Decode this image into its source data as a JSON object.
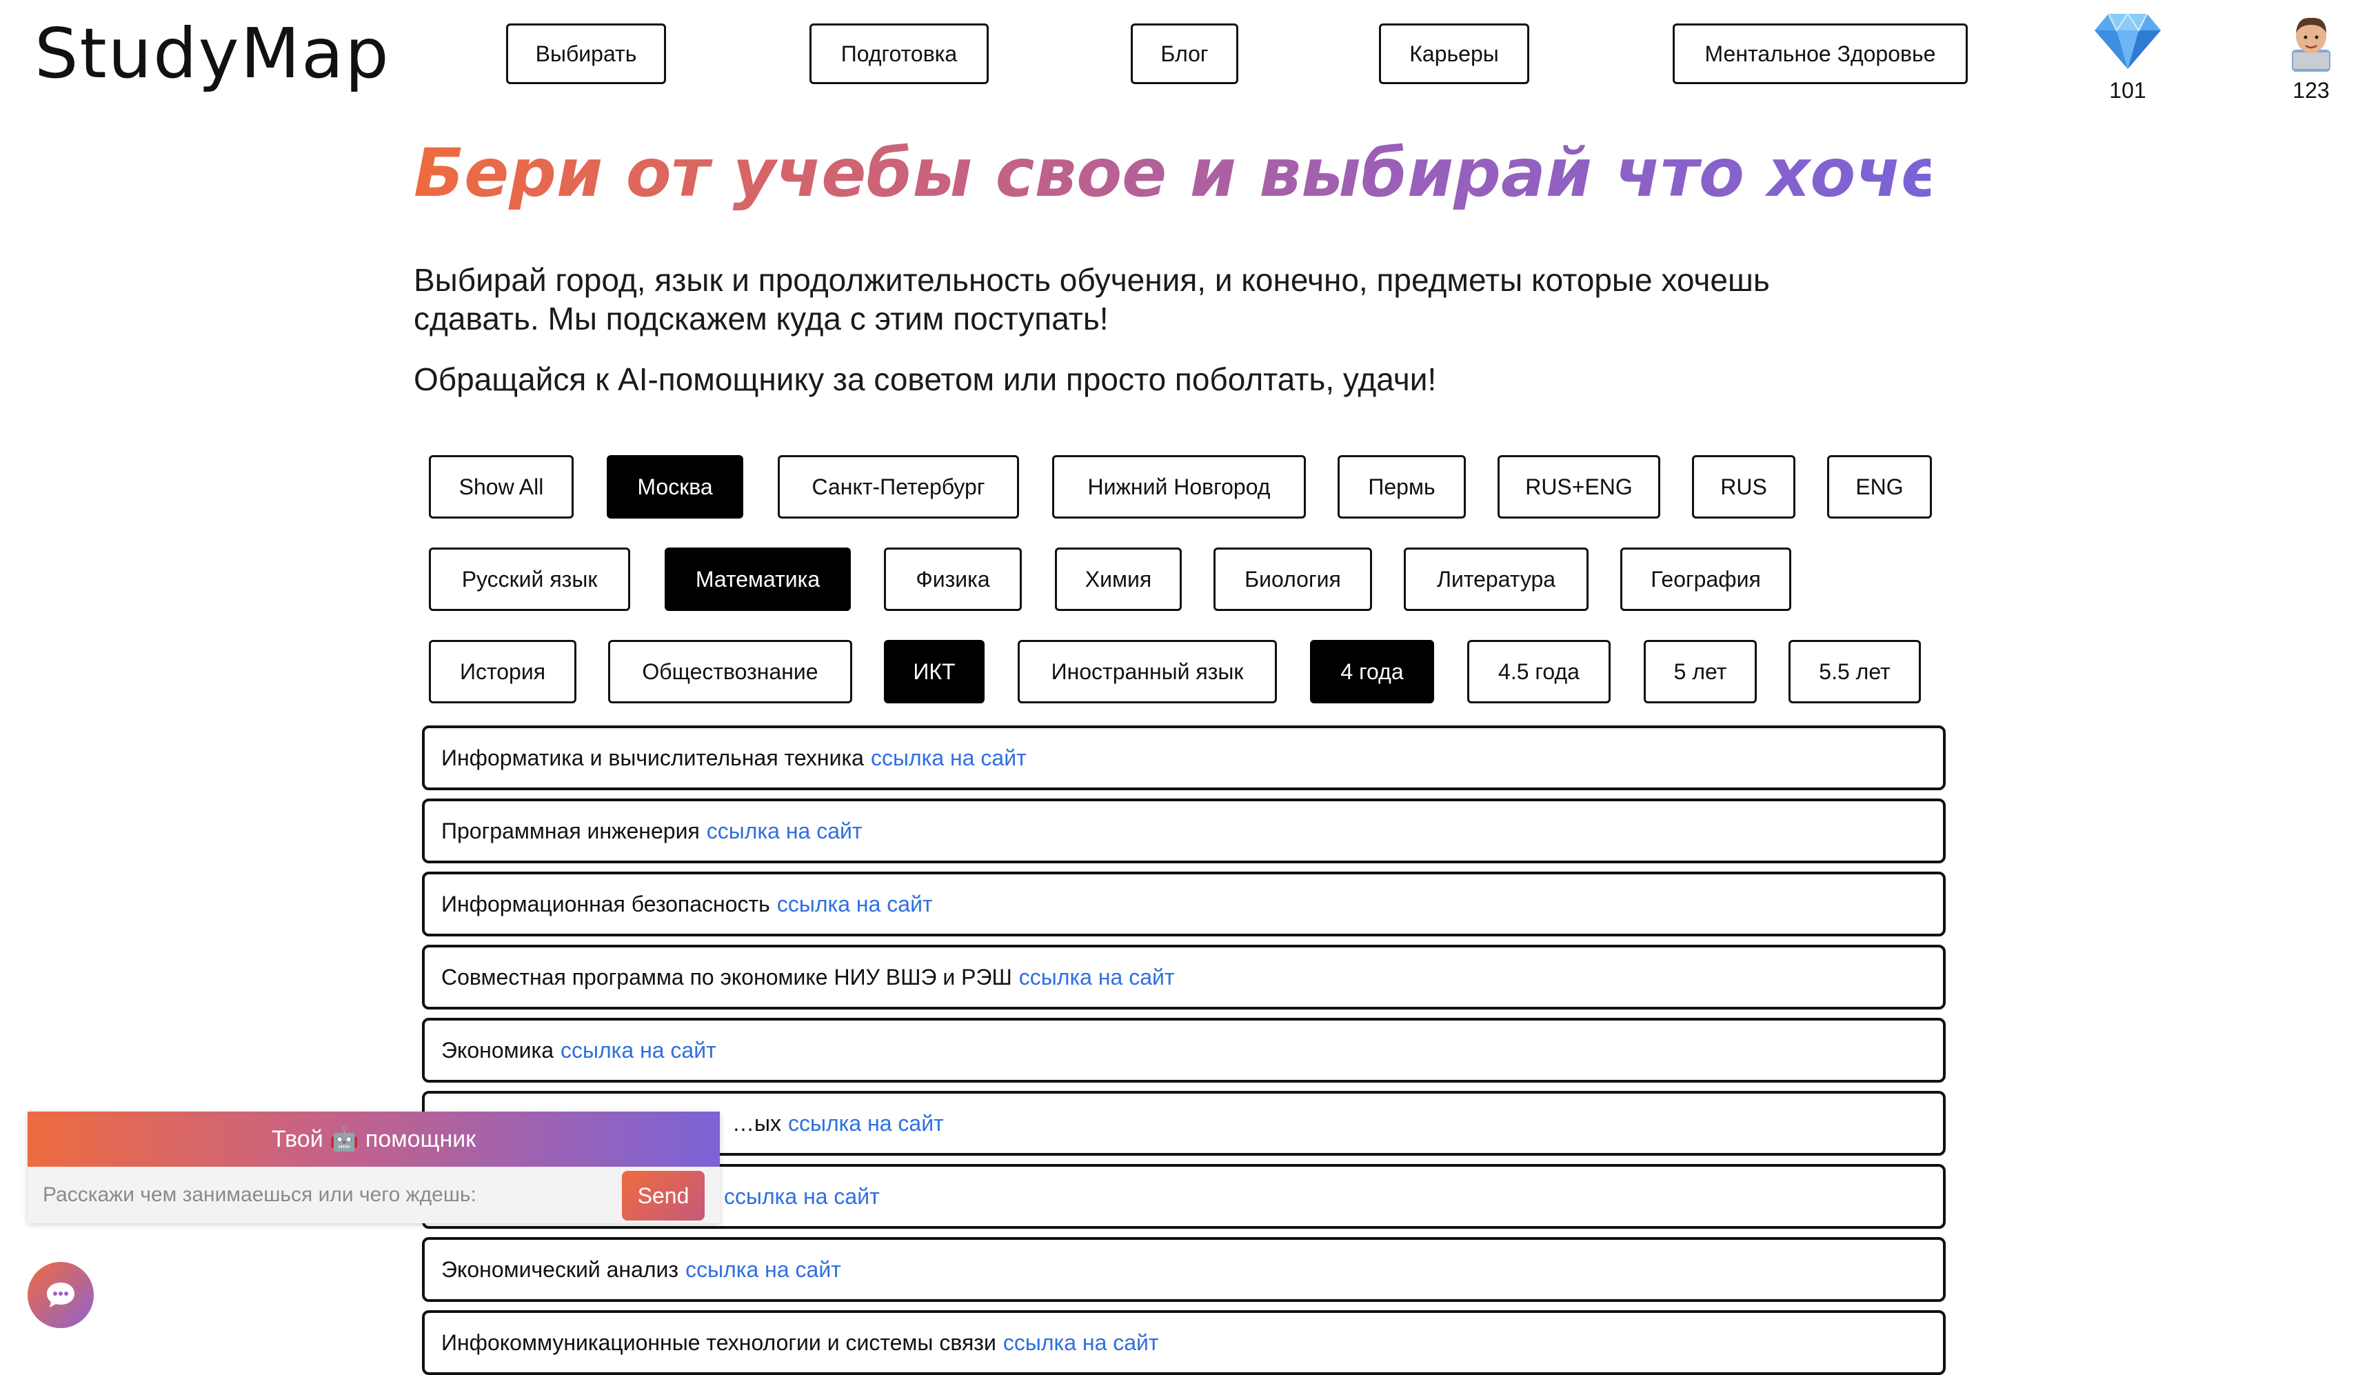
{
  "logo": "StudyMap",
  "nav": [
    {
      "label": "Выбирать",
      "active": true
    },
    {
      "label": "Подготовка",
      "active": true
    },
    {
      "label": "Блог",
      "active": false
    },
    {
      "label": "Карьеры",
      "active": false
    },
    {
      "label": "Ментальное Здоровье",
      "active": false
    }
  ],
  "stats": {
    "gems": "101",
    "profile": "123"
  },
  "hero": {
    "title": "Бери от учебы свое и выбирай что хочешь!",
    "p1": "Выбирай город, язык и продолжительность обучения, и конечно, предметы которые хочешь сдавать. Мы подскажем куда с этим поступать!",
    "p2": "Обращайся к AI-помощнику за советом или просто поболтать, удачи!"
  },
  "filters": [
    [
      {
        "label": "Show All",
        "active": false
      },
      {
        "label": "Москва",
        "active": true
      },
      {
        "label": "Санкт-Петербург",
        "active": false
      },
      {
        "label": "Нижний Новгород",
        "active": false
      },
      {
        "label": "Пермь",
        "active": false
      },
      {
        "label": "RUS+ENG",
        "active": false
      },
      {
        "label": "RUS",
        "active": false
      },
      {
        "label": "ENG",
        "active": false
      }
    ],
    [
      {
        "label": "Русский язык",
        "active": false
      },
      {
        "label": "Математика",
        "active": true
      },
      {
        "label": "Физика",
        "active": false
      },
      {
        "label": "Химия",
        "active": false
      },
      {
        "label": "Биология",
        "active": false
      },
      {
        "label": "Литература",
        "active": false
      },
      {
        "label": "География",
        "active": false
      }
    ],
    [
      {
        "label": "История",
        "active": false
      },
      {
        "label": "Обществознание",
        "active": false
      },
      {
        "label": "ИКТ",
        "active": true
      },
      {
        "label": "Иностранный язык",
        "active": false
      },
      {
        "label": "4 года",
        "active": true
      },
      {
        "label": "4.5 года",
        "active": false
      },
      {
        "label": "5 лет",
        "active": false
      },
      {
        "label": "5.5 лет",
        "active": false
      }
    ]
  ],
  "link_label": "ссылка на сайт",
  "results": [
    {
      "name": "Информатика и вычислительная техника"
    },
    {
      "name": "Программная инженерия"
    },
    {
      "name": "Информационная безопасность"
    },
    {
      "name": "Совместная программа по экономике НИУ ВШЭ и РЭШ"
    },
    {
      "name": "Экономика"
    },
    {
      "name": "…ых"
    },
    {
      "name": ""
    },
    {
      "name": "Экономический анализ"
    },
    {
      "name": "Инфокоммуникационные технологии и системы связи"
    }
  ],
  "chat": {
    "title": "Твой 🤖 помощник",
    "placeholder": "Расскажи чем занимаешься или чего ждешь:",
    "send": "Send"
  }
}
